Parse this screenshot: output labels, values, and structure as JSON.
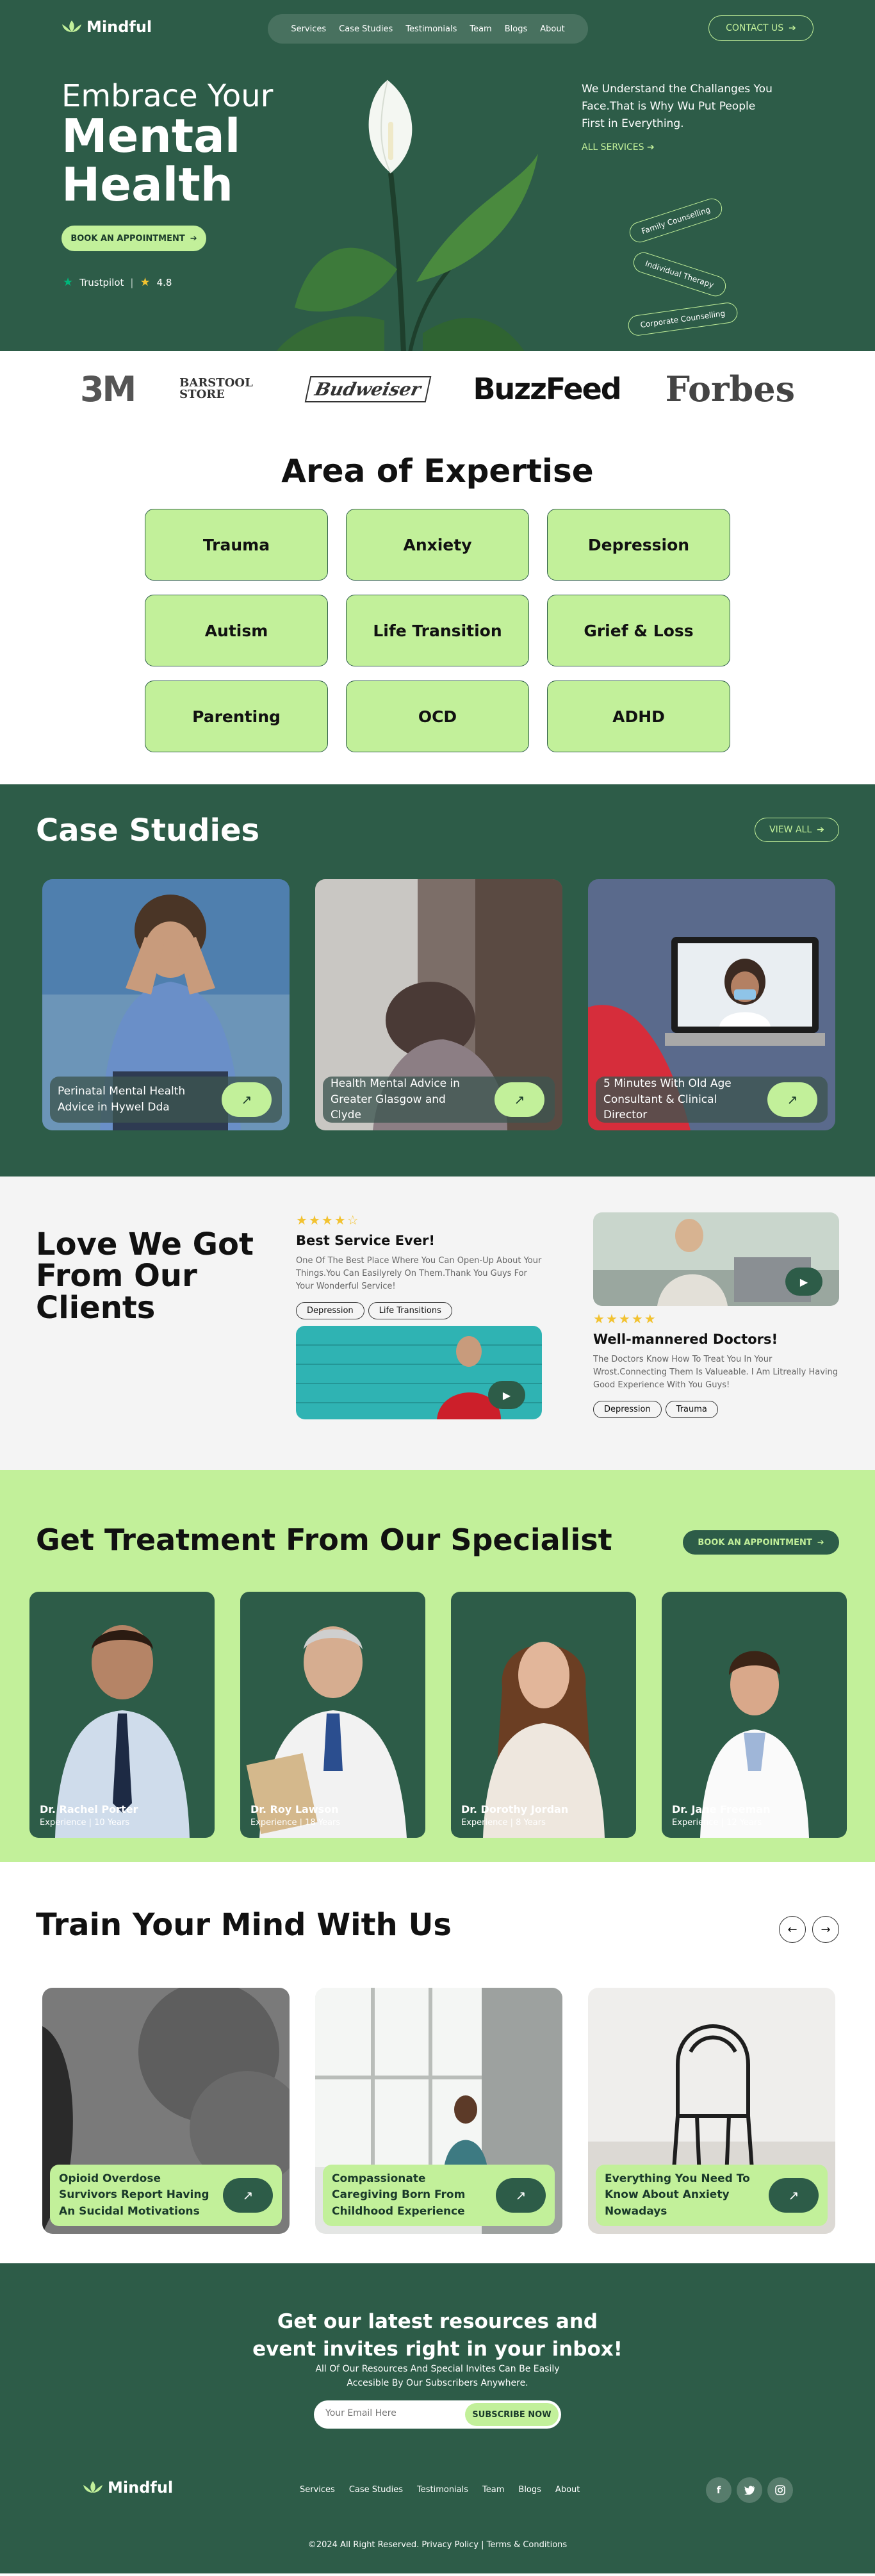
{
  "brand": {
    "name": "Mindful",
    "accent": "#c2f09a",
    "primary": "#2d5c48"
  },
  "nav": {
    "links": [
      "Services",
      "Case Studies",
      "Testimonials",
      "Team",
      "Blogs",
      "About"
    ],
    "contact_label": "CONTACT US"
  },
  "hero": {
    "title_line1": "Embrace Your",
    "title_line2": "Mental",
    "title_line3": "Health",
    "cta_label": "BOOK AN APPOINTMENT",
    "trustpilot_label": "Trustpilot",
    "rating": "4.8",
    "description": "We Understand the Challanges You Face.That is Why Wu Put People First in Everything.",
    "all_services_label": "ALL SERVICES",
    "tags": [
      "Family Counselling",
      "Individual Therapy",
      "Corporate Counselling"
    ]
  },
  "brands": [
    "3M",
    "BARSTOOL STORE",
    "Budweiser",
    "BuzzFeed",
    "Forbes"
  ],
  "expertise": {
    "title": "Area of Expertise",
    "items": [
      "Trauma",
      "Anxiety",
      "Depression",
      "Autism",
      "Life Transition",
      "Grief & Loss",
      "Parenting",
      "OCD",
      "ADHD"
    ]
  },
  "cases": {
    "title": "Case Studies",
    "view_all_label": "VIEW ALL",
    "items": [
      {
        "title": "Perinatal Mental Health Advice in Hywel Dda"
      },
      {
        "title": "Health Mental Advice in Greater Glasgow and Clyde"
      },
      {
        "title": "5 Minutes With Old Age Consultant & Clinical Director"
      }
    ]
  },
  "love": {
    "title": "Love We Got From Our Clients",
    "t1": {
      "rating": 4,
      "title": "Best Service Ever!",
      "body": "One Of The Best Place Where You Can Open-Up About Your Things.You Can Easilyrely On Them.Thank You Guys For Your Wonderful Service!",
      "tags": [
        "Depression",
        "Life Transitions"
      ]
    },
    "t2": {
      "rating": 5,
      "title": "Well-mannered Doctors!",
      "body": "The Doctors Know How To Treat You In Your Wrost.Connecting Them Is Valueable. I Am Litreally Having Good Experience With You Guys!",
      "tags": [
        "Depression",
        "Trauma"
      ]
    }
  },
  "specialists": {
    "title": "Get Treatment From Our Specialist",
    "cta_label": "BOOK AN APPOINTMENT",
    "items": [
      {
        "name": "Dr. Rachel Porter",
        "exp": "Experience | 10 Years"
      },
      {
        "name": "Dr. Roy Lawson",
        "exp": "Experience | 18 Years"
      },
      {
        "name": "Dr. Dorothy Jordan",
        "exp": "Experience | 8 Years"
      },
      {
        "name": "Dr. Jane Freeman",
        "exp": "Experience | 12 Years"
      }
    ]
  },
  "train": {
    "title": "Train Your Mind With Us",
    "items": [
      {
        "title": "Opioid Overdose Survivors Report Having An Sucidal Motivations"
      },
      {
        "title": "Compassionate Caregiving Born From Childhood Experience"
      },
      {
        "title": "Everything You Need To Know About Anxiety Nowadays"
      }
    ]
  },
  "newsletter": {
    "title_line1": "Get our latest resources and",
    "title_line2": "event invites right in your inbox!",
    "sub_line1": "All Of Our Resources And Special Invites Can Be Easily",
    "sub_line2": "Accesible By Our Subscribers Anywhere.",
    "placeholder": "Your Email Here",
    "subscribe_label": "SUBSCRIBE NOW"
  },
  "footer": {
    "links": [
      "Services",
      "Case Studies",
      "Testimonials",
      "Team",
      "Blogs",
      "About"
    ],
    "social": [
      "facebook-icon",
      "twitter-icon",
      "instagram-icon"
    ],
    "copyright": "©2024 All Right Reserved. Privacy Policy | Terms & Conditions"
  }
}
